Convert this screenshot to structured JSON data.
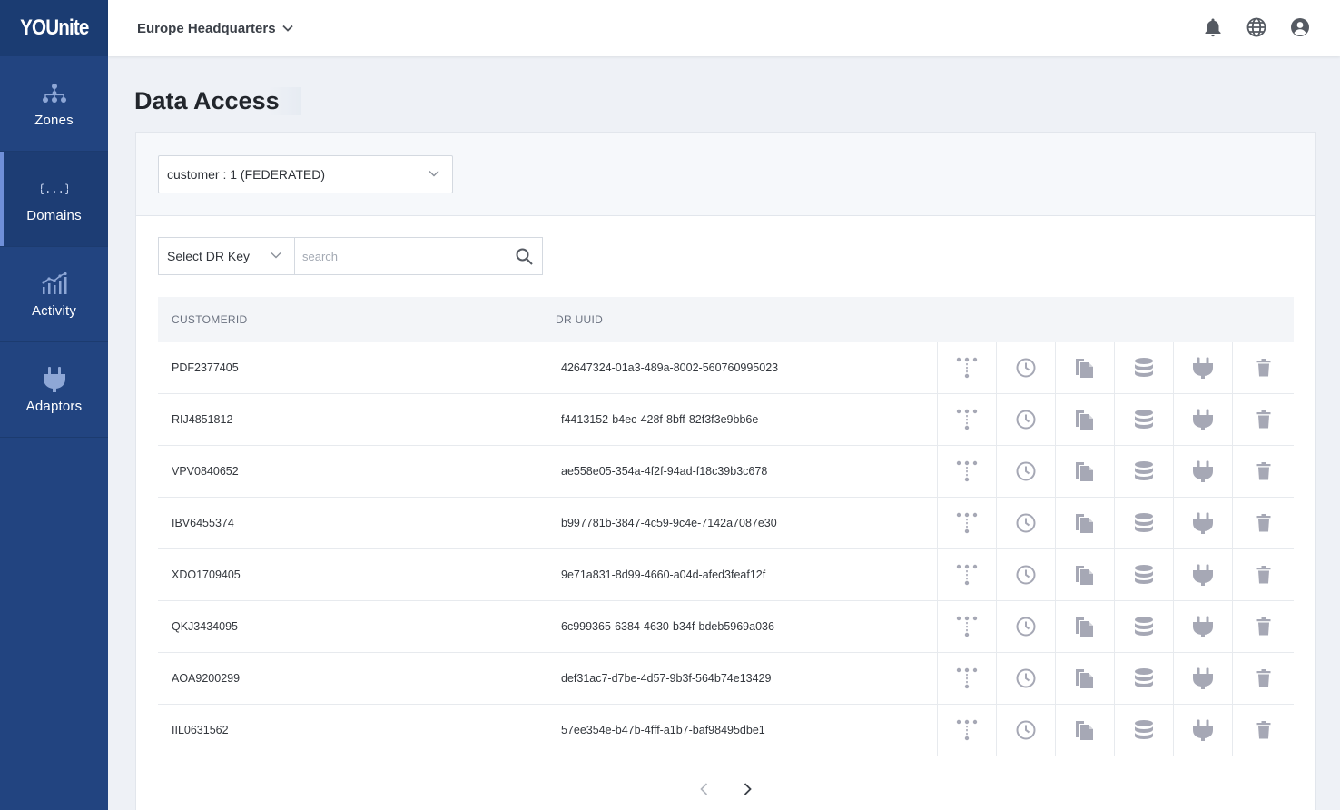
{
  "app": {
    "logo": "YOUnite"
  },
  "sidebar": {
    "items": [
      {
        "label": "Zones",
        "icon": "zones-hierarchy-icon"
      },
      {
        "label": "Domains",
        "icon": "domains-braces-icon",
        "active": true
      },
      {
        "label": "Activity",
        "icon": "activity-chart-icon"
      },
      {
        "label": "Adaptors",
        "icon": "adaptor-plug-icon"
      }
    ]
  },
  "header": {
    "org": "Europe Headquarters",
    "icons": [
      "bell-icon",
      "globe-icon",
      "account-circle-icon"
    ]
  },
  "page": {
    "title": "Data Access"
  },
  "domain_select": {
    "value": "customer : 1 (FEDERATED)"
  },
  "filter": {
    "dr_key": "Select DR Key",
    "search_placeholder": "search"
  },
  "table": {
    "columns": [
      "CUSTOMERID",
      "DR UUID"
    ],
    "row_actions": [
      "lineage-icon",
      "history-icon",
      "copy-icon",
      "database-icon",
      "adaptor-plug-icon",
      "trash-icon"
    ],
    "rows": [
      {
        "id": "PDF2377405",
        "uuid": "42647324-01a3-489a-8002-560760995023"
      },
      {
        "id": "RIJ4851812",
        "uuid": "f4413152-b4ec-428f-8bff-82f3f3e9bb6e"
      },
      {
        "id": "VPV0840652",
        "uuid": "ae558e05-354a-4f2f-94ad-f18c39b3c678"
      },
      {
        "id": "IBV6455374",
        "uuid": "b997781b-3847-4c59-9c4e-7142a7087e30"
      },
      {
        "id": "XDO1709405",
        "uuid": "9e71a831-8d99-4660-a04d-afed3feaf12f"
      },
      {
        "id": "QKJ3434095",
        "uuid": "6c999365-6384-4630-b34f-bdeb5969a036"
      },
      {
        "id": "AOA9200299",
        "uuid": "def31ac7-d7be-4d57-9b3f-564b74e13429"
      },
      {
        "id": "IIL0631562",
        "uuid": "57ee354e-b47b-4fff-a1b7-baf98495dbe1"
      }
    ]
  },
  "colors": {
    "sidebar": "#224480",
    "accent": "#6f8fd8",
    "icon_muted": "#a6a8b5"
  }
}
